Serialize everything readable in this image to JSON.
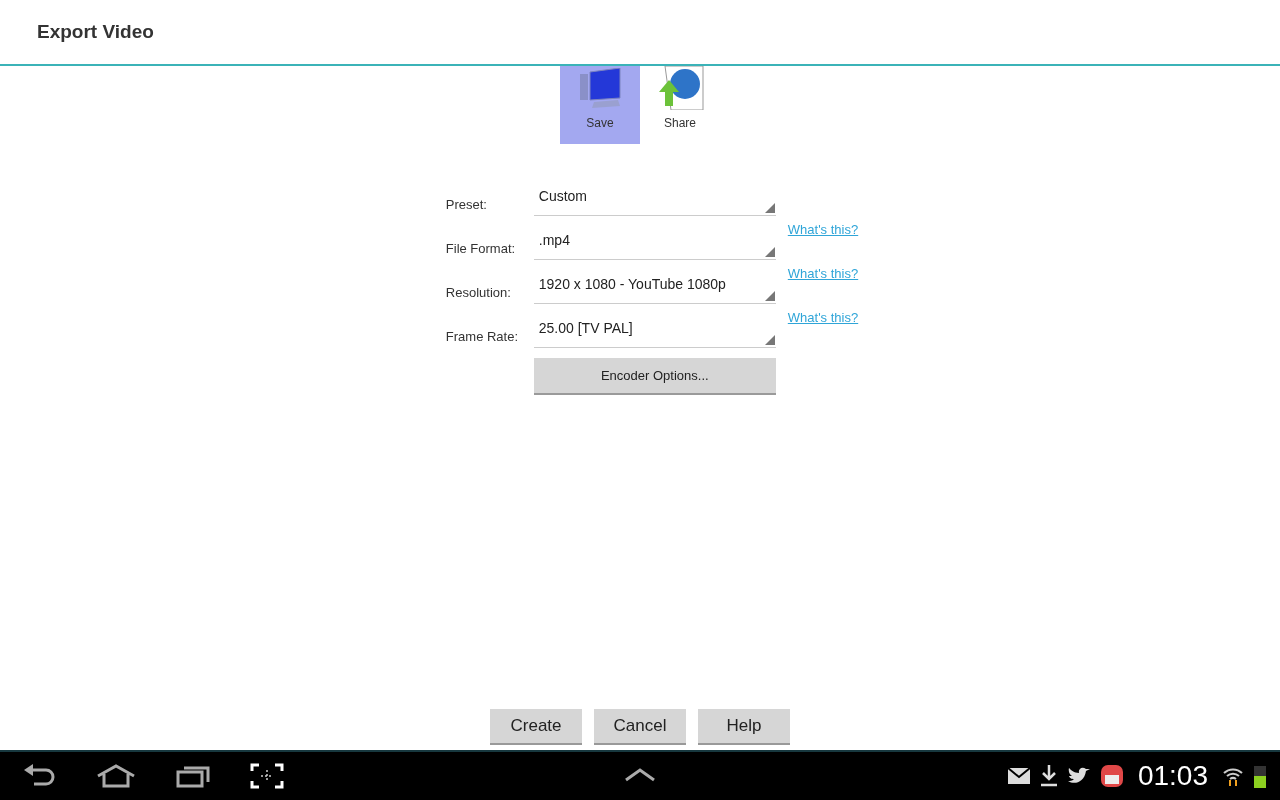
{
  "title": "Export Video",
  "targets": [
    {
      "label": "Save",
      "kind": "save",
      "selected": true
    },
    {
      "label": "Share",
      "kind": "share",
      "selected": false
    }
  ],
  "fields": [
    {
      "label": "Preset:",
      "value": "Custom"
    },
    {
      "label": "File Format:",
      "value": ".mp4",
      "link": "What's this?"
    },
    {
      "label": "Resolution:",
      "value": "1920 x 1080 - YouTube 1080p",
      "link": "What's this?"
    },
    {
      "label": "Frame Rate:",
      "value": "25.00 [TV PAL]",
      "link": "What's this?"
    }
  ],
  "encoder_button": "Encoder Options...",
  "buttons": [
    "Create",
    "Cancel",
    "Help"
  ],
  "status_bar": {
    "time": "01:03"
  }
}
